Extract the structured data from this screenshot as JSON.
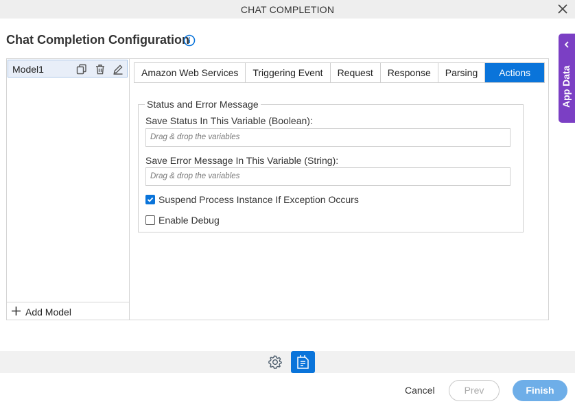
{
  "window": {
    "title": "CHAT COMPLETION"
  },
  "heading": "Chat Completion Configuration",
  "models": {
    "items": [
      {
        "label": "Model1"
      }
    ],
    "add_label": "Add Model"
  },
  "tabs": [
    {
      "label": "Amazon Web Services"
    },
    {
      "label": "Triggering Event"
    },
    {
      "label": "Request"
    },
    {
      "label": "Response"
    },
    {
      "label": "Parsing"
    },
    {
      "label": "Actions",
      "active": true
    }
  ],
  "actions": {
    "legend": "Status and Error Message",
    "status_label": "Save Status In This Variable (Boolean):",
    "status_placeholder": "Drag & drop the variables",
    "error_label": "Save Error Message In This Variable (String):",
    "error_placeholder": "Drag & drop the variables",
    "suspend_label": "Suspend Process Instance If Exception Occurs",
    "suspend_checked": true,
    "debug_label": "Enable Debug",
    "debug_checked": false
  },
  "side_panel": {
    "label": "App Data"
  },
  "footer": {
    "cancel": "Cancel",
    "prev": "Prev",
    "finish": "Finish"
  },
  "colors": {
    "accent": "#0a74da",
    "side_tab": "#7b3fc4",
    "finish_bg": "#6eaee8"
  },
  "icons": [
    "close-icon",
    "info-icon",
    "duplicate-icon",
    "trash-icon",
    "edit-icon",
    "plus-icon",
    "chevron-left-icon",
    "gear-icon",
    "document-icon",
    "checkbox-checked-icon"
  ]
}
